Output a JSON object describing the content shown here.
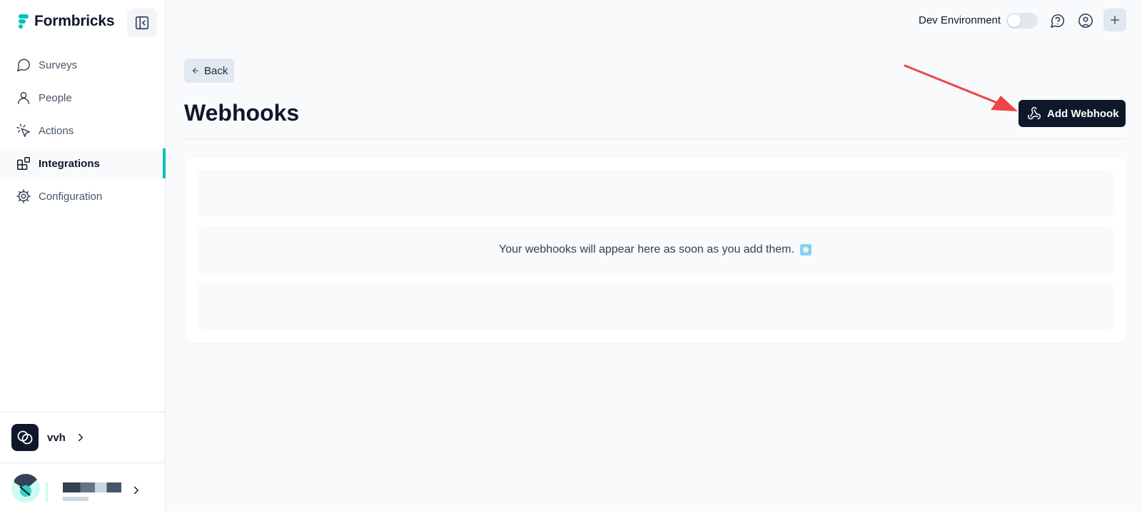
{
  "brand": {
    "name": "Formbricks",
    "accent": "#00c4b8"
  },
  "sidebar": {
    "items": [
      {
        "label": "Surveys",
        "icon": "message-circle-icon",
        "active": false
      },
      {
        "label": "People",
        "icon": "user-icon",
        "active": false
      },
      {
        "label": "Actions",
        "icon": "cursor-click-icon",
        "active": false
      },
      {
        "label": "Integrations",
        "icon": "blocks-icon",
        "active": true
      },
      {
        "label": "Configuration",
        "icon": "settings-gear-icon",
        "active": false
      }
    ],
    "organization": {
      "name": "vvh"
    }
  },
  "topbar": {
    "environment_label": "Dev Environment",
    "environment_toggle_on": false
  },
  "main": {
    "back_label": "Back",
    "title": "Webhooks",
    "add_button_label": "Add Webhook",
    "empty_message": "Your webhooks will appear here as soon as you add them."
  },
  "colors": {
    "primary_dark": "#0f172a",
    "annotation_arrow": "#ef4444",
    "background": "#f8fafc"
  }
}
